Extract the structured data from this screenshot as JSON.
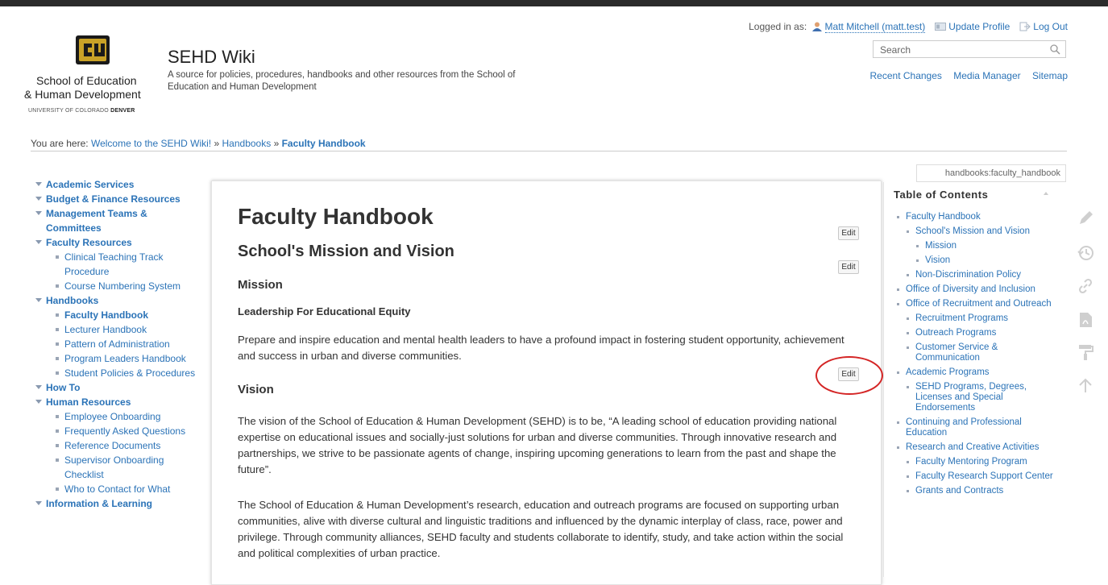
{
  "header": {
    "logo": {
      "line1": "School of Education",
      "line2": "& Human Development",
      "line3a": "UNIVERSITY OF COLORADO ",
      "line3b": "DENVER"
    },
    "site_title": "SEHD Wiki",
    "tagline": "A source for policies, procedures, handbooks and other resources from the School of Education and Human Development"
  },
  "userbar": {
    "logged_in_label": "Logged in as:",
    "username": "Matt Mitchell (matt.test)",
    "update_profile": "Update Profile",
    "log_out": "Log Out"
  },
  "search": {
    "placeholder": "Search"
  },
  "tools": {
    "recent_changes": "Recent Changes",
    "media_manager": "Media Manager",
    "sitemap": "Sitemap"
  },
  "breadcrumb": {
    "prefix": "You are here:",
    "home": "Welcome to the SEHD Wiki!",
    "sep": "»",
    "parent": "Handbooks",
    "current": "Faculty Handbook"
  },
  "sidebar": {
    "academic_services": "Academic Services",
    "budget_finance": "Budget & Finance Resources",
    "management_teams": "Management Teams & Committees",
    "faculty_resources": "Faculty Resources",
    "clinical_teaching": "Clinical Teaching Track Procedure",
    "course_numbering": "Course Numbering System",
    "handbooks": "Handbooks",
    "faculty_handbook": "Faculty Handbook",
    "lecturer_handbook": "Lecturer Handbook",
    "pattern_admin": "Pattern of Administration",
    "program_leaders": "Program Leaders Handbook",
    "student_policies": "Student Policies & Procedures",
    "how_to": "How To",
    "human_resources": "Human Resources",
    "employee_onboarding": "Employee Onboarding",
    "faq": "Frequently Asked Questions",
    "reference_docs": "Reference Documents",
    "supervisor_onboarding": "Supervisor Onboarding Checklist",
    "who_to_contact": "Who to Contact for What",
    "info_learning": "Information & Learning"
  },
  "content": {
    "title": "Faculty Handbook",
    "section_title": "School's Mission and Vision",
    "mission_heading": "Mission",
    "mission_subheading": "Leadership For Educational Equity",
    "mission_text": "Prepare and inspire education and mental health leaders to have a profound impact in fostering student opportunity, achievement and success in urban and diverse communities.",
    "vision_heading": "Vision",
    "vision_text": "The vision of the School of Education & Human Development (SEHD) is to be, “A leading school of education providing national expertise on educational issues and socially-just solutions for urban and diverse communities. Through innovative research and partnerships, we strive to be passionate agents of change, inspiring upcoming generations to learn from the past and shape the future”.",
    "programs_text": "The School of Education & Human Development’s research, education and outreach programs are focused on supporting urban communities, alive with diverse cultural and linguistic traditions and influenced by the dynamic interplay of class, race, power and privilege. Through community alliances, SEHD faculty and students collaborate to identify, study, and take action within the social and political complexities of urban practice.",
    "edit_label": "Edit"
  },
  "page_id": "handbooks:faculty_handbook",
  "toc": {
    "heading": "Table of Contents",
    "items": [
      "Faculty Handbook",
      "School's Mission and Vision",
      "Mission",
      "Vision",
      "Non-Discrimination Policy",
      "Office of Diversity and Inclusion",
      "Office of Recruitment and Outreach",
      "Recruitment Programs",
      "Outreach Programs",
      "Customer Service & Communication",
      "Academic Programs",
      "SEHD Programs, Degrees, Licenses and Special Endorsements",
      "Continuing and Professional Education",
      "Research and Creative Activities",
      "Faculty Mentoring Program",
      "Faculty Research Support Center",
      "Grants and Contracts"
    ]
  },
  "colors": {
    "link": "#2b73b7",
    "annotation": "#d42525",
    "logo_gold": "#c9a227"
  }
}
